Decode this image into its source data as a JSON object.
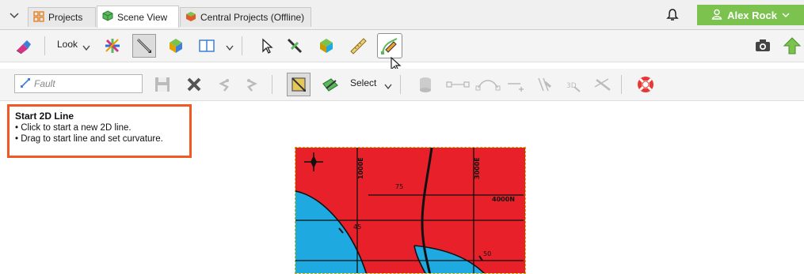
{
  "tabs": {
    "menu_icon": "chevron-down-icon",
    "items": [
      {
        "label": "Projects",
        "icon": "projects-grid-icon"
      },
      {
        "label": "Scene View",
        "icon": "cube-icon"
      },
      {
        "label": "Central Projects (Offline)",
        "icon": "central-projects-icon"
      }
    ],
    "active": "Scene View"
  },
  "header": {
    "bell_icon": "bell-icon",
    "user_name": "Alex Rock"
  },
  "toolbar1": {
    "look_label": "Look",
    "tools": [
      "eraser-icon",
      "axes-icon",
      "pen-icon",
      "puzzle-icon",
      "panel-layout-icon",
      "pointer-icon",
      "green-line-pen-icon",
      "polygon-icon",
      "ruler-icon",
      "start-2d-line-icon",
      "camera-icon",
      "upload-icon"
    ]
  },
  "toolbar2": {
    "fault_placeholder": "Fault",
    "select_label": "Select",
    "tools": [
      "save-icon",
      "delete-icon",
      "undo-icon",
      "redo-icon",
      "draw-polygon-icon",
      "edit-polygon-icon",
      "cylinder-icon",
      "link-point-icon",
      "curve-icon",
      "add-point-icon",
      "split-icon",
      "3d-icon",
      "trim-icon",
      "lifebuoy-icon"
    ]
  },
  "tooltip": {
    "title": "Start 2D Line",
    "lines": [
      "• Click to start a new 2D line.",
      "• Drag to start line and set curvature."
    ]
  },
  "map": {
    "labels": {
      "e1000": "1000E",
      "e3000": "3000E",
      "n4000": "4000N",
      "d75": "75",
      "d45": "45",
      "d50": "50"
    },
    "colors": {
      "red": "#e8202a",
      "blue": "#1ea9e1"
    }
  }
}
